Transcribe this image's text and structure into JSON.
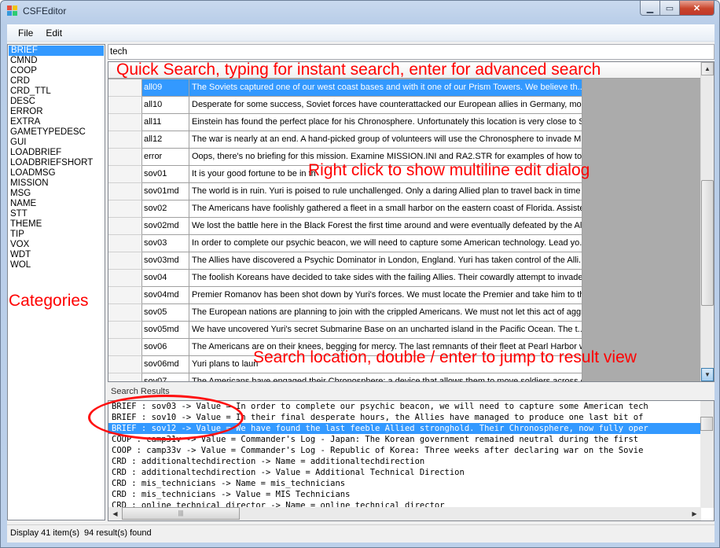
{
  "window": {
    "title": "CSFEditor",
    "min_label": "▁",
    "max_label": "▭",
    "close_label": "✕"
  },
  "menu": [
    "File",
    "Edit"
  ],
  "categories": [
    "BRIEF",
    "CMND",
    "COOP",
    "CRD",
    "CRD_TTL",
    "DESC",
    "ERROR",
    "EXTRA",
    "GAMETYPEDESC",
    "GUI",
    "LOADBRIEF",
    "LOADBRIEFSHORT",
    "LOADMSG",
    "MISSION",
    "MSG",
    "NAME",
    "STT",
    "THEME",
    "TIP",
    "VOX",
    "WDT",
    "WOL"
  ],
  "selected_category": "BRIEF",
  "search": {
    "value": "tech"
  },
  "grid_rows": [
    {
      "key": "all09",
      "value": "The Soviets captured one of our west coast bases and with it one of our Prism Towers. We believe th...",
      "selected": true
    },
    {
      "key": "all10",
      "value": "Desperate for some success, Soviet forces have counterattacked our European allies in Germany, mo..."
    },
    {
      "key": "all11",
      "value": "Einstein has found the perfect place for his Chronosphere. Unfortunately this location is very close to S..."
    },
    {
      "key": "all12",
      "value": "The war is nearly at an end. A hand-picked group of volunteers will use the Chronosphere to invade M..."
    },
    {
      "key": "error",
      "value": "Oops, there's no briefing for this mission. Examine MISSION.INI and RA2.STR for examples of how to ..."
    },
    {
      "key": "sov01",
      "value": "It is your good fortune to be in th"
    },
    {
      "key": "sov01md",
      "value": "The world is in ruin. Yuri is poised to rule unchallenged. Only a daring Allied plan to travel back in time s..."
    },
    {
      "key": "sov02",
      "value": "The Americans have foolishly gathered a fleet in a small harbor on the eastern coast of Florida. Assiste..."
    },
    {
      "key": "sov02md",
      "value": "We lost the battle here in the Black Forest the first time around and were eventually defeated by the All..."
    },
    {
      "key": "sov03",
      "value": "In order to complete our psychic beacon, we will need to capture some American technology. Lead yo..."
    },
    {
      "key": "sov03md",
      "value": "The Allies have discovered a Psychic Dominator in London, England. Yuri has taken control of the Alli..."
    },
    {
      "key": "sov04",
      "value": "The foolish Koreans have decided to take sides with the failing Allies. Their cowardly attempt to invade..."
    },
    {
      "key": "sov04md",
      "value": "Premier Romanov has been shot down by Yuri's forces. We must locate the Premier and take him to th..."
    },
    {
      "key": "sov05",
      "value": "The European nations are planning to join with the crippled Americans. We must not let this act of aggr..."
    },
    {
      "key": "sov05md",
      "value": "We have uncovered Yuri's secret Submarine Base on an uncharted island in the Pacific Ocean. The t..."
    },
    {
      "key": "sov06",
      "value": "The Americans are on their knees, begging for mercy. The last remnants of their fleet at Pearl Harbor w..."
    },
    {
      "key": "sov06md",
      "value": "Yuri plans to laun"
    },
    {
      "key": "sov07",
      "value": "The Americans have engaged their Chronosphere; a device that allows them to move soldiers across g..."
    }
  ],
  "results_label": "Search Results",
  "results": [
    {
      "text": "BRIEF : sov03 -> Value = In order to complete our psychic beacon, we will need to capture some American tech"
    },
    {
      "text": "BRIEF : sov10 -> Value = In their final desperate hours, the Allies have managed to produce one last bit of"
    },
    {
      "text": "BRIEF : sov12 -> Value = We have found the last feeble Allied stronghold. Their Chronosphere, now fully oper",
      "selected": true
    },
    {
      "text": "COOP : camp31v -> Value = Commander's Log - Japan: The Korean government remained neutral during the first"
    },
    {
      "text": "COOP : camp33v -> Value = Commander's Log - Republic of Korea: Three weeks after declaring war on the Sovie"
    },
    {
      "text": "CRD : additionaltechdirection -> Name = additionaltechdirection"
    },
    {
      "text": "CRD : additionaltechdirection -> Value = Additional Technical Direction"
    },
    {
      "text": "CRD : mis_technicians -> Name = mis_technicians"
    },
    {
      "text": "CRD : mis_technicians -> Value = MIS Technicians"
    },
    {
      "text": "CRD : online_technical_director -> Name = online_technical_director"
    }
  ],
  "status": {
    "display": "Display 41 item(s)",
    "found": "94 result(s) found"
  },
  "annotations": {
    "quick_search": "Quick Search, typing for instant search, enter for advanced search",
    "right_click": "Right click to show multiline edit dialog",
    "categories": "Categories",
    "search_location": "Search location, double / enter to jump to result view"
  },
  "colors": {
    "selection": "#3399ff",
    "annotation": "#ff0000",
    "close_button": "#c9452b"
  }
}
